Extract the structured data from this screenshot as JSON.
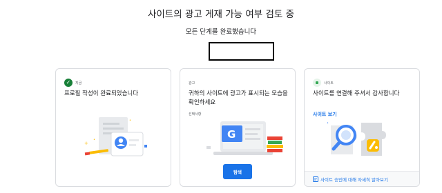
{
  "header": {
    "title": "사이트의 광고 게재 가능 여부 검토 중",
    "subtitle": "모든 단계를 완료했습니다"
  },
  "cards": [
    {
      "status_label": "지금",
      "title": "프로필 작성이 완료되었습니다",
      "status_icon": "check-circle-icon",
      "status_color": "#188038"
    },
    {
      "status_label": "광고",
      "title": "귀하의 사이트에 광고가 표시되는 모습을 확인하세요",
      "sub_label": "선택사항",
      "button_label": "탐색",
      "accent": "#1a73e8"
    },
    {
      "status_label": "사이트",
      "title": "사이트를 연결해 주셔서 감사합니다",
      "link_label": "사이트 보기",
      "footer_link": "사이트 승인에 대해 자세히 알아보기",
      "status_icon": "site-dot-icon",
      "status_color": "#34a853"
    }
  ],
  "colors": {
    "link": "#1a73e8",
    "border": "#dadce0",
    "text": "#202124",
    "muted": "#5f6368"
  }
}
